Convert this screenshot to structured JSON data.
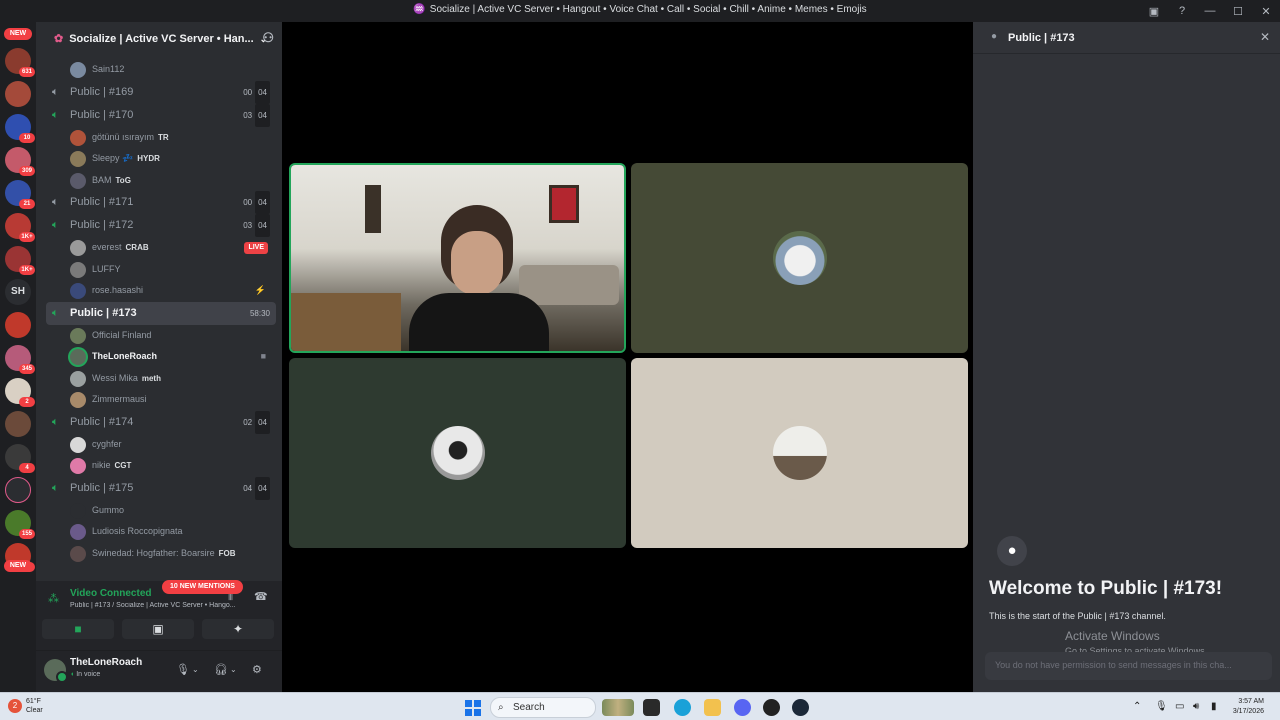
{
  "window": {
    "title": "Socialize | Active VC Server • Hangout • Voice Chat • Call • Social • Chill • Anime • Memes • Emojis"
  },
  "rail": {
    "new_top": "NEW",
    "badges": [
      "631",
      "",
      "10",
      "309",
      "21",
      "1K+",
      "1K+",
      "",
      "345",
      "2",
      "",
      "4",
      "",
      "155",
      "45"
    ],
    "text_server": "SH",
    "new_bottom": "NEW"
  },
  "guild": {
    "name": "Socialize | Active VC Server • Han..."
  },
  "channels": {
    "sain_member": "Sain112",
    "c169": {
      "name": "Public | #169",
      "count": "00",
      "cap": "04"
    },
    "c170": {
      "name": "Public | #170",
      "count": "03",
      "cap": "04"
    },
    "c170_members": [
      {
        "name": "götünü ısırayım",
        "tag": "TR"
      },
      {
        "name": "Sleepy 💤",
        "tag": "HYDR"
      },
      {
        "name": "BAM",
        "tag": "ToG"
      }
    ],
    "c171": {
      "name": "Public | #171",
      "count": "00",
      "cap": "04"
    },
    "c172": {
      "name": "Public | #172",
      "count": "03",
      "cap": "04"
    },
    "c172_members": [
      {
        "name": "everest",
        "tag": "CRAB",
        "badge": "LIVE"
      },
      {
        "name": "LUFFY"
      },
      {
        "name": "rose.hasashi"
      }
    ],
    "c173": {
      "name": "Public | #173",
      "timer": "58:30"
    },
    "c173_members": [
      {
        "name": "Official Finland"
      },
      {
        "name": "TheLoneRoach"
      },
      {
        "name": "Wessi Mika",
        "tag": "meth"
      },
      {
        "name": "Zimmermausi"
      }
    ],
    "c174": {
      "name": "Public | #174",
      "count": "02",
      "cap": "04"
    },
    "c174_members": [
      {
        "name": "cyghfer"
      },
      {
        "name": "nikie",
        "tag": "CGT"
      }
    ],
    "c175": {
      "name": "Public | #175",
      "count": "04",
      "cap": "04"
    },
    "c175_members": [
      {
        "name": "Gummo"
      },
      {
        "name": "Ludiosis Roccopignata"
      },
      {
        "name": "Swinedad: Hogfather: Boarsire",
        "tag": "FOB"
      }
    ],
    "mentions": "10 NEW MENTIONS"
  },
  "voice": {
    "status": "Video Connected",
    "channel": "Public | #173 / Socialize | Active VC Server • Hango..."
  },
  "user": {
    "name": "TheLoneRoach",
    "status": "In voice"
  },
  "chat": {
    "title": "Public | #173",
    "welcome": "Welcome to Public | #173!",
    "subtitle": "This is the start of the Public | #173 channel.",
    "no_permission": "You do not have permission to send messages in this cha..."
  },
  "activation": {
    "title": "Activate Windows",
    "subtitle": "Go to Settings to activate Windows."
  },
  "taskbar": {
    "temp": "61°F",
    "condition": "Clear",
    "search": "Search",
    "time": "3:57 AM",
    "date": "3/17/2026"
  },
  "colors": {
    "accent_green": "#23a55a",
    "danger": "#f23f43",
    "tile_olive": "#454a36",
    "tile_dark_green": "#2e3a30",
    "tile_beige": "#d2cbbf"
  }
}
